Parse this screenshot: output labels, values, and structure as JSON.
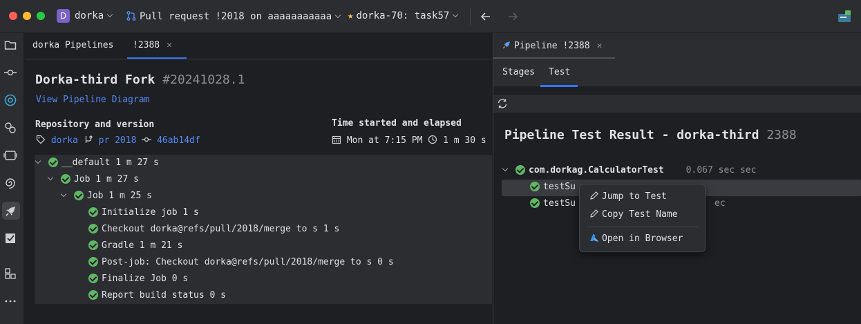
{
  "titlebar": {
    "project_initial": "D",
    "project_name": "dorka",
    "pull_request": "Pull request !2018 on aaaaaaaaaaa",
    "branch_task": "dorka-70: task57"
  },
  "left_tabs": [
    {
      "label": "dorka Pipelines"
    },
    {
      "label": "!2388"
    }
  ],
  "pipeline": {
    "name": "Dorka-third Fork",
    "run_number": "#20241028.1",
    "diagram_link": "View Pipeline Diagram",
    "repo_label": "Repository and version",
    "repo_name": "dorka",
    "branch": "pr 2018",
    "commit": "46ab14df",
    "time_label": "Time started and elapsed",
    "started": "Mon at 7:15 PM",
    "elapsed": "1 m 30 s"
  },
  "job_tree": [
    {
      "label": "__default 1 m 27 s",
      "status": "success"
    },
    {
      "label": "Job 1 m 27 s",
      "status": "success"
    },
    {
      "label": "Job 1 m 25 s",
      "status": "success"
    },
    {
      "label": "Initialize job 1 s",
      "status": "success"
    },
    {
      "label": "Checkout dorka@refs/pull/2018/merge to s 1 s",
      "status": "success"
    },
    {
      "label": "Gradle 1 m 21 s",
      "status": "success"
    },
    {
      "label": "Post-job: Checkout dorka@refs/pull/2018/merge to s 0 s",
      "status": "success"
    },
    {
      "label": "Finalize Job 0 s",
      "status": "success"
    },
    {
      "label": "Report build status 0 s",
      "status": "success"
    }
  ],
  "right_tab": {
    "label": "Pipeline !2388"
  },
  "subtabs": [
    {
      "label": "Stages"
    },
    {
      "label": "Test"
    }
  ],
  "test_result": {
    "title": "Pipeline Test Result - dorka-third",
    "run": "2388",
    "suite": "com.dorkag.CalculatorTest",
    "suite_time": "0.067 sec sec",
    "tests": [
      {
        "name": "testSu",
        "time": ""
      },
      {
        "name": "testSu",
        "time": "ec"
      }
    ]
  },
  "context_menu": {
    "items": [
      {
        "label": "Jump to Test"
      },
      {
        "label": "Copy Test Name"
      },
      {
        "label": "Open in Browser"
      }
    ]
  },
  "colors": {
    "accent": "#3574f0",
    "link": "#548af7",
    "success": "#5fb865",
    "project_avatar": "#7b61c9"
  }
}
